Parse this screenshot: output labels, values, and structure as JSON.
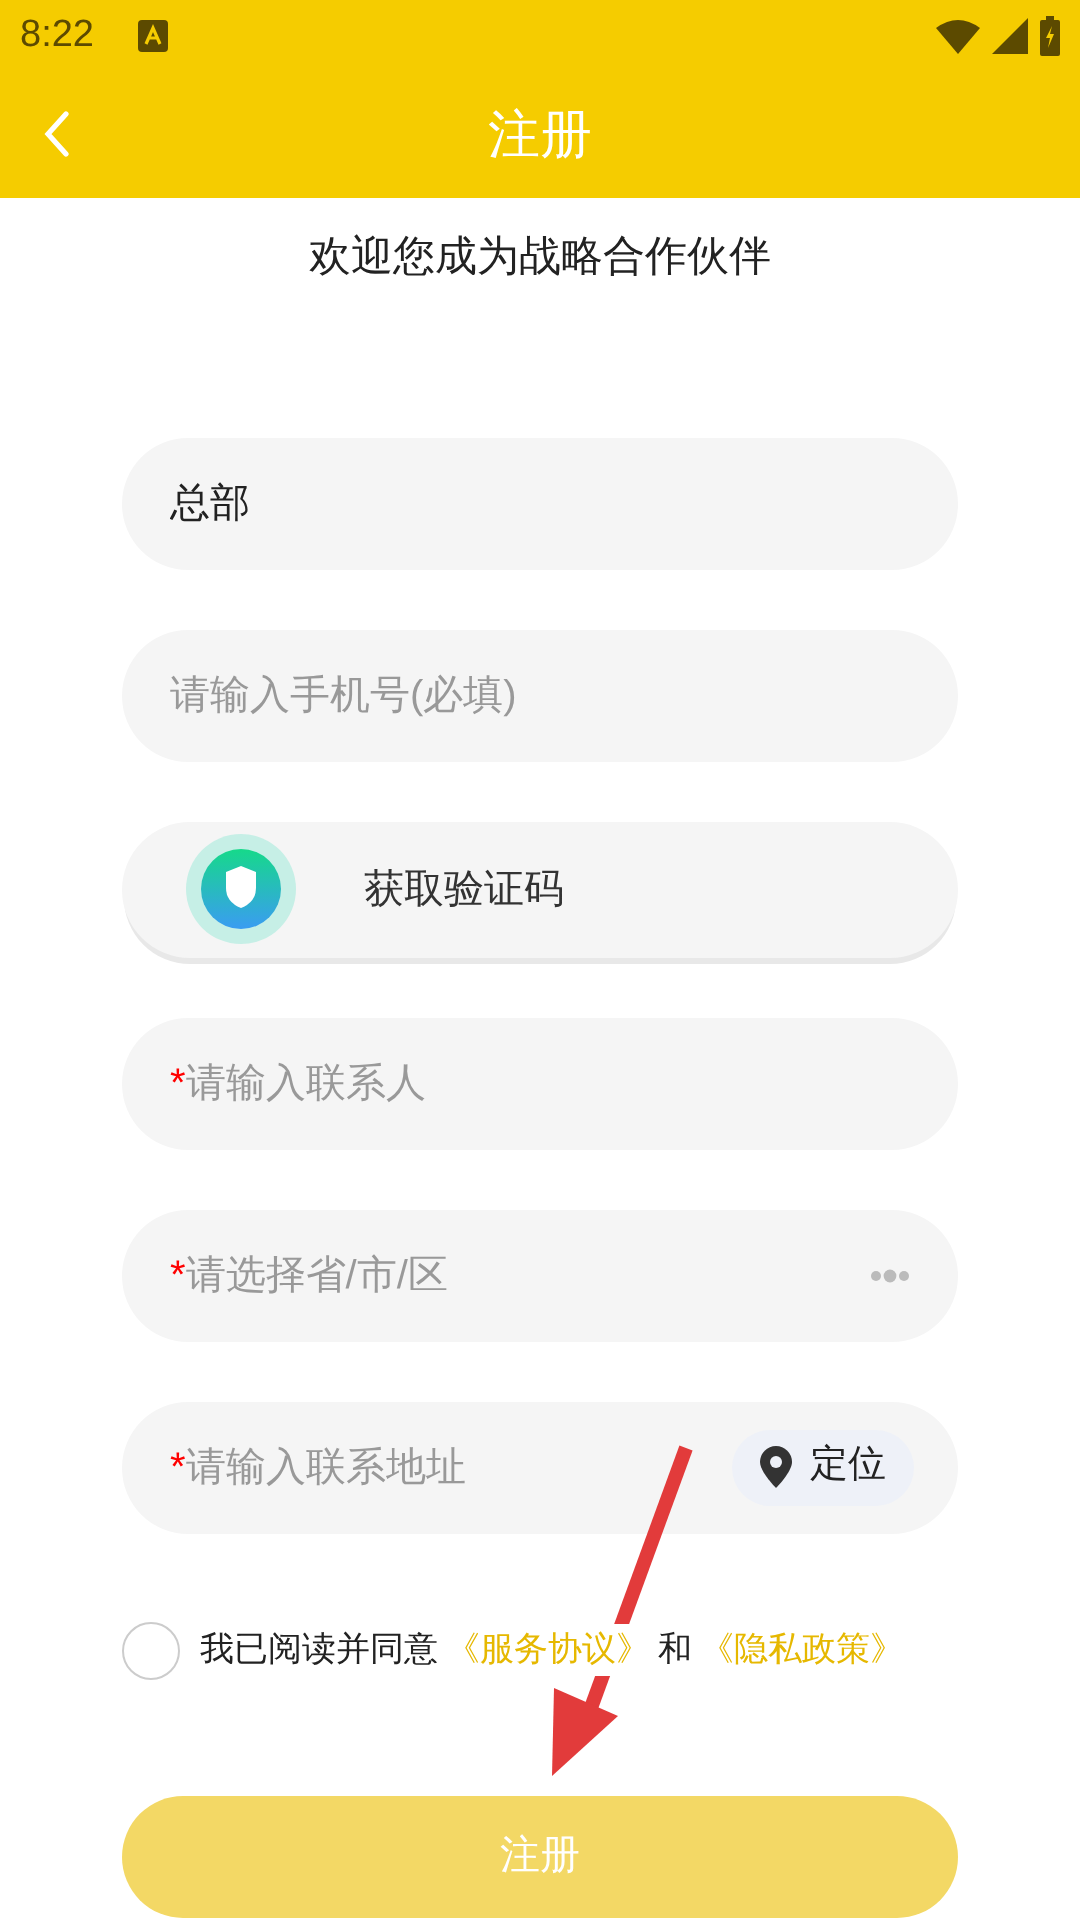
{
  "status_bar": {
    "time": "8:22"
  },
  "header": {
    "title": "注册"
  },
  "subtitle": "欢迎您成为战略合作伙伴",
  "fields": [
    {
      "kind": "text",
      "value": "总部"
    },
    {
      "kind": "text",
      "placeholder": "请输入手机号(必填)"
    },
    {
      "kind": "code",
      "button_label": "获取验证码"
    },
    {
      "kind": "text",
      "placeholder": "请输入联系人",
      "mark": "*"
    },
    {
      "kind": "select",
      "placeholder": "请选择省/市/区",
      "mark": "*"
    },
    {
      "kind": "address",
      "placeholder": "请输入联系地址",
      "mark": "*",
      "locate_label": "定位"
    }
  ],
  "agreement": {
    "checked": false,
    "parts": [
      {
        "kind": "text",
        "text": "我已阅读并同意"
      },
      {
        "kind": "link",
        "text": "《服务协议》"
      },
      {
        "kind": "text",
        "text": "和"
      },
      {
        "kind": "link",
        "text": "《隐私政策》"
      }
    ]
  },
  "submit": {
    "label": "注册",
    "disabled": true
  }
}
